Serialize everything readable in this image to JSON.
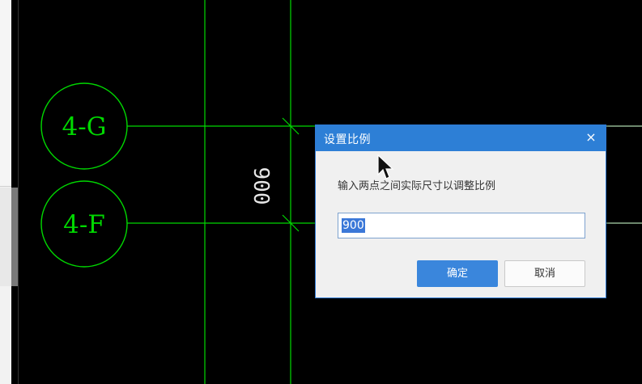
{
  "drawing": {
    "axis_labels": [
      "4-G",
      "4-F"
    ],
    "dimension_text": "900",
    "line_color": "#00d800"
  },
  "dialog": {
    "title": "设置比例",
    "close_label": "×",
    "prompt": "输入两点之间实际尺寸以调整比例",
    "input_value": "900",
    "ok_label": "确定",
    "cancel_label": "取消",
    "accent_color": "#2d7fd6"
  }
}
